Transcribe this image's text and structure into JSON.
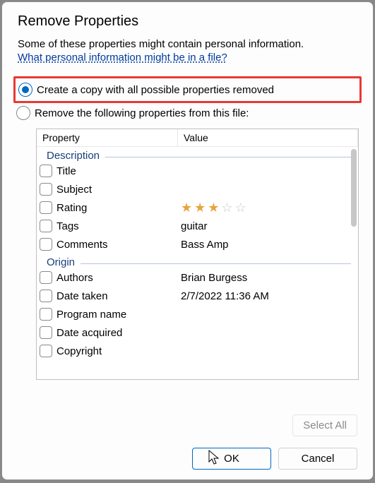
{
  "dialog": {
    "title": "Remove Properties",
    "intro": "Some of these properties might contain personal information.",
    "link": "What personal information might be in a file?",
    "option1": "Create a copy with all possible properties removed",
    "option2": "Remove the following properties from this file:"
  },
  "columns": {
    "property": "Property",
    "value": "Value"
  },
  "groups": {
    "description": "Description",
    "origin": "Origin"
  },
  "props": {
    "title": {
      "name": "Title",
      "value": ""
    },
    "subject": {
      "name": "Subject",
      "value": ""
    },
    "rating": {
      "name": "Rating",
      "stars": 3
    },
    "tags": {
      "name": "Tags",
      "value": "guitar"
    },
    "comments": {
      "name": "Comments",
      "value": "Bass Amp"
    },
    "authors": {
      "name": "Authors",
      "value": "Brian Burgess"
    },
    "date_taken": {
      "name": "Date taken",
      "value": "2/7/2022 11:36 AM"
    },
    "program_name": {
      "name": "Program name",
      "value": ""
    },
    "date_acquired": {
      "name": "Date acquired",
      "value": ""
    },
    "copyright": {
      "name": "Copyright",
      "value": ""
    }
  },
  "buttons": {
    "select_all": "Select All",
    "ok": "OK",
    "cancel": "Cancel"
  }
}
